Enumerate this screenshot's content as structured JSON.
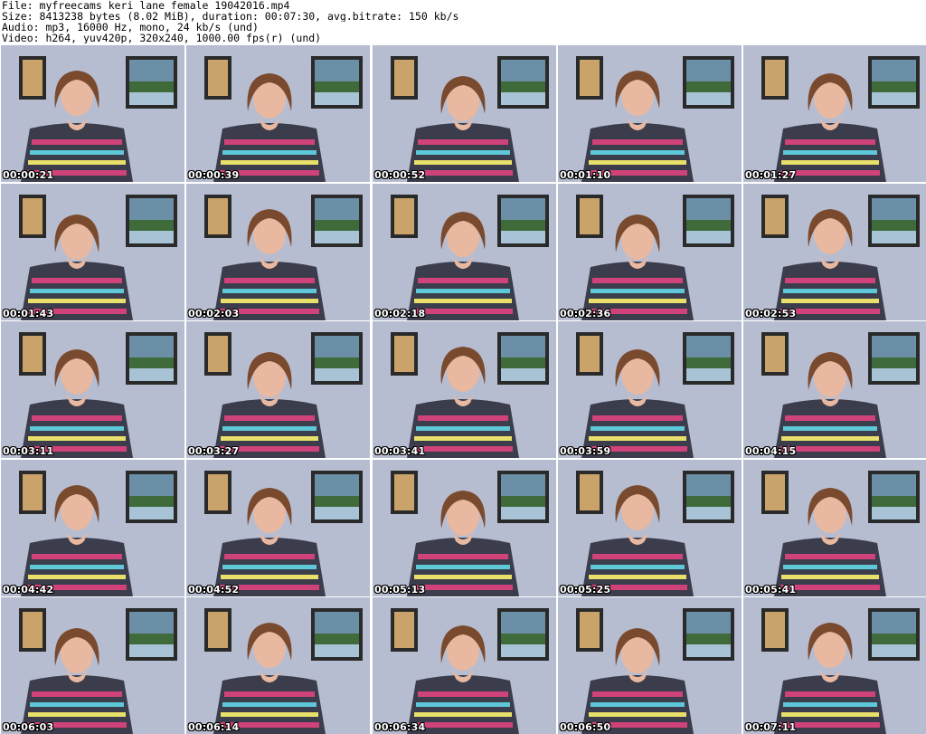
{
  "header": {
    "line1": "File: myfreecams_keri_lane_female_19042016.mp4",
    "line2": "Size: 8413238 bytes (8.02 MiB), duration: 00:07:30, avg.bitrate: 150 kb/s",
    "line3": "Audio: mp3, 16000 Hz, mono, 24 kb/s (und)",
    "line4": "Video: h264, yuv420p, 320x240, 1000.00 fps(r) (und)"
  },
  "colors": {
    "wall": "#b7bdd1",
    "frame": "#2a2a2a",
    "hair": "#7a4a2e",
    "skin": "#e8b8a0",
    "shirt": "#3b3d4c",
    "pattern_pink": "#d0427a",
    "pattern_cyan": "#5ec8d8",
    "pattern_yellow": "#e8e06a"
  },
  "thumbnails": [
    {
      "timestamp": "00:00:21"
    },
    {
      "timestamp": "00:00:39"
    },
    {
      "timestamp": "00:00:52"
    },
    {
      "timestamp": "00:01:10"
    },
    {
      "timestamp": "00:01:27"
    },
    {
      "timestamp": "00:01:43"
    },
    {
      "timestamp": "00:02:03"
    },
    {
      "timestamp": "00:02:18"
    },
    {
      "timestamp": "00:02:36"
    },
    {
      "timestamp": "00:02:53"
    },
    {
      "timestamp": "00:03:11"
    },
    {
      "timestamp": "00:03:27"
    },
    {
      "timestamp": "00:03:41"
    },
    {
      "timestamp": "00:03:59"
    },
    {
      "timestamp": "00:04:15"
    },
    {
      "timestamp": "00:04:42"
    },
    {
      "timestamp": "00:04:52"
    },
    {
      "timestamp": "00:05:13"
    },
    {
      "timestamp": "00:05:25"
    },
    {
      "timestamp": "00:05:41"
    },
    {
      "timestamp": "00:06:03"
    },
    {
      "timestamp": "00:06:14"
    },
    {
      "timestamp": "00:06:34"
    },
    {
      "timestamp": "00:06:50"
    },
    {
      "timestamp": "00:07:11"
    }
  ]
}
